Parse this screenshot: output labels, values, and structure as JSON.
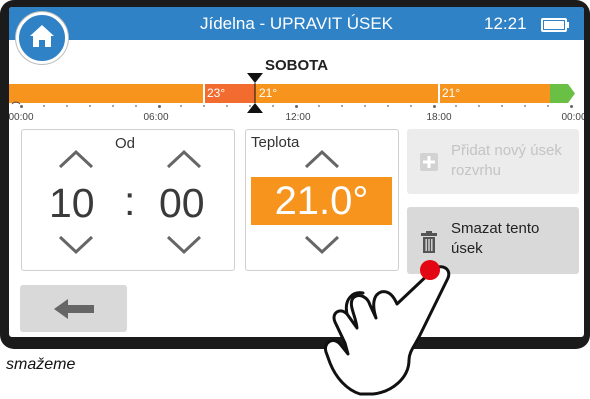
{
  "header": {
    "title": "Jídelna - UPRAVIT ÚSEK",
    "time": "12:21"
  },
  "icons": {
    "home": "home-icon",
    "battery": "battery-icon",
    "add": "plus-icon",
    "delete": "trash-icon",
    "back": "arrow-left-icon",
    "hand": "pointing-hand-icon"
  },
  "colors": {
    "header": "#2f82c5",
    "segment": "#f7941d",
    "selected_segment": "#f26b2f",
    "end_marker": "#6abf45",
    "accent": "#f7941d"
  },
  "day": "SOBOTA",
  "timeline": {
    "segments": [
      {
        "label": "",
        "color": "#f7941d"
      },
      {
        "label": "23°",
        "color": "#f26b2f"
      },
      {
        "label": "21°",
        "color": "#f7941d"
      },
      {
        "label": "21°",
        "color": "#f7941d"
      }
    ],
    "time_labels": [
      "00:00",
      "06:00",
      "12:00",
      "18:00",
      "00:00"
    ]
  },
  "from": {
    "label": "Od",
    "hours": "10",
    "separator": ":",
    "minutes": "00"
  },
  "temperature": {
    "label": "Teplota",
    "value": "21.0°"
  },
  "buttons": {
    "add": "Přidat nový úsek rozvrhu",
    "delete": "Smazat tento úsek"
  },
  "caption": "smažeme"
}
